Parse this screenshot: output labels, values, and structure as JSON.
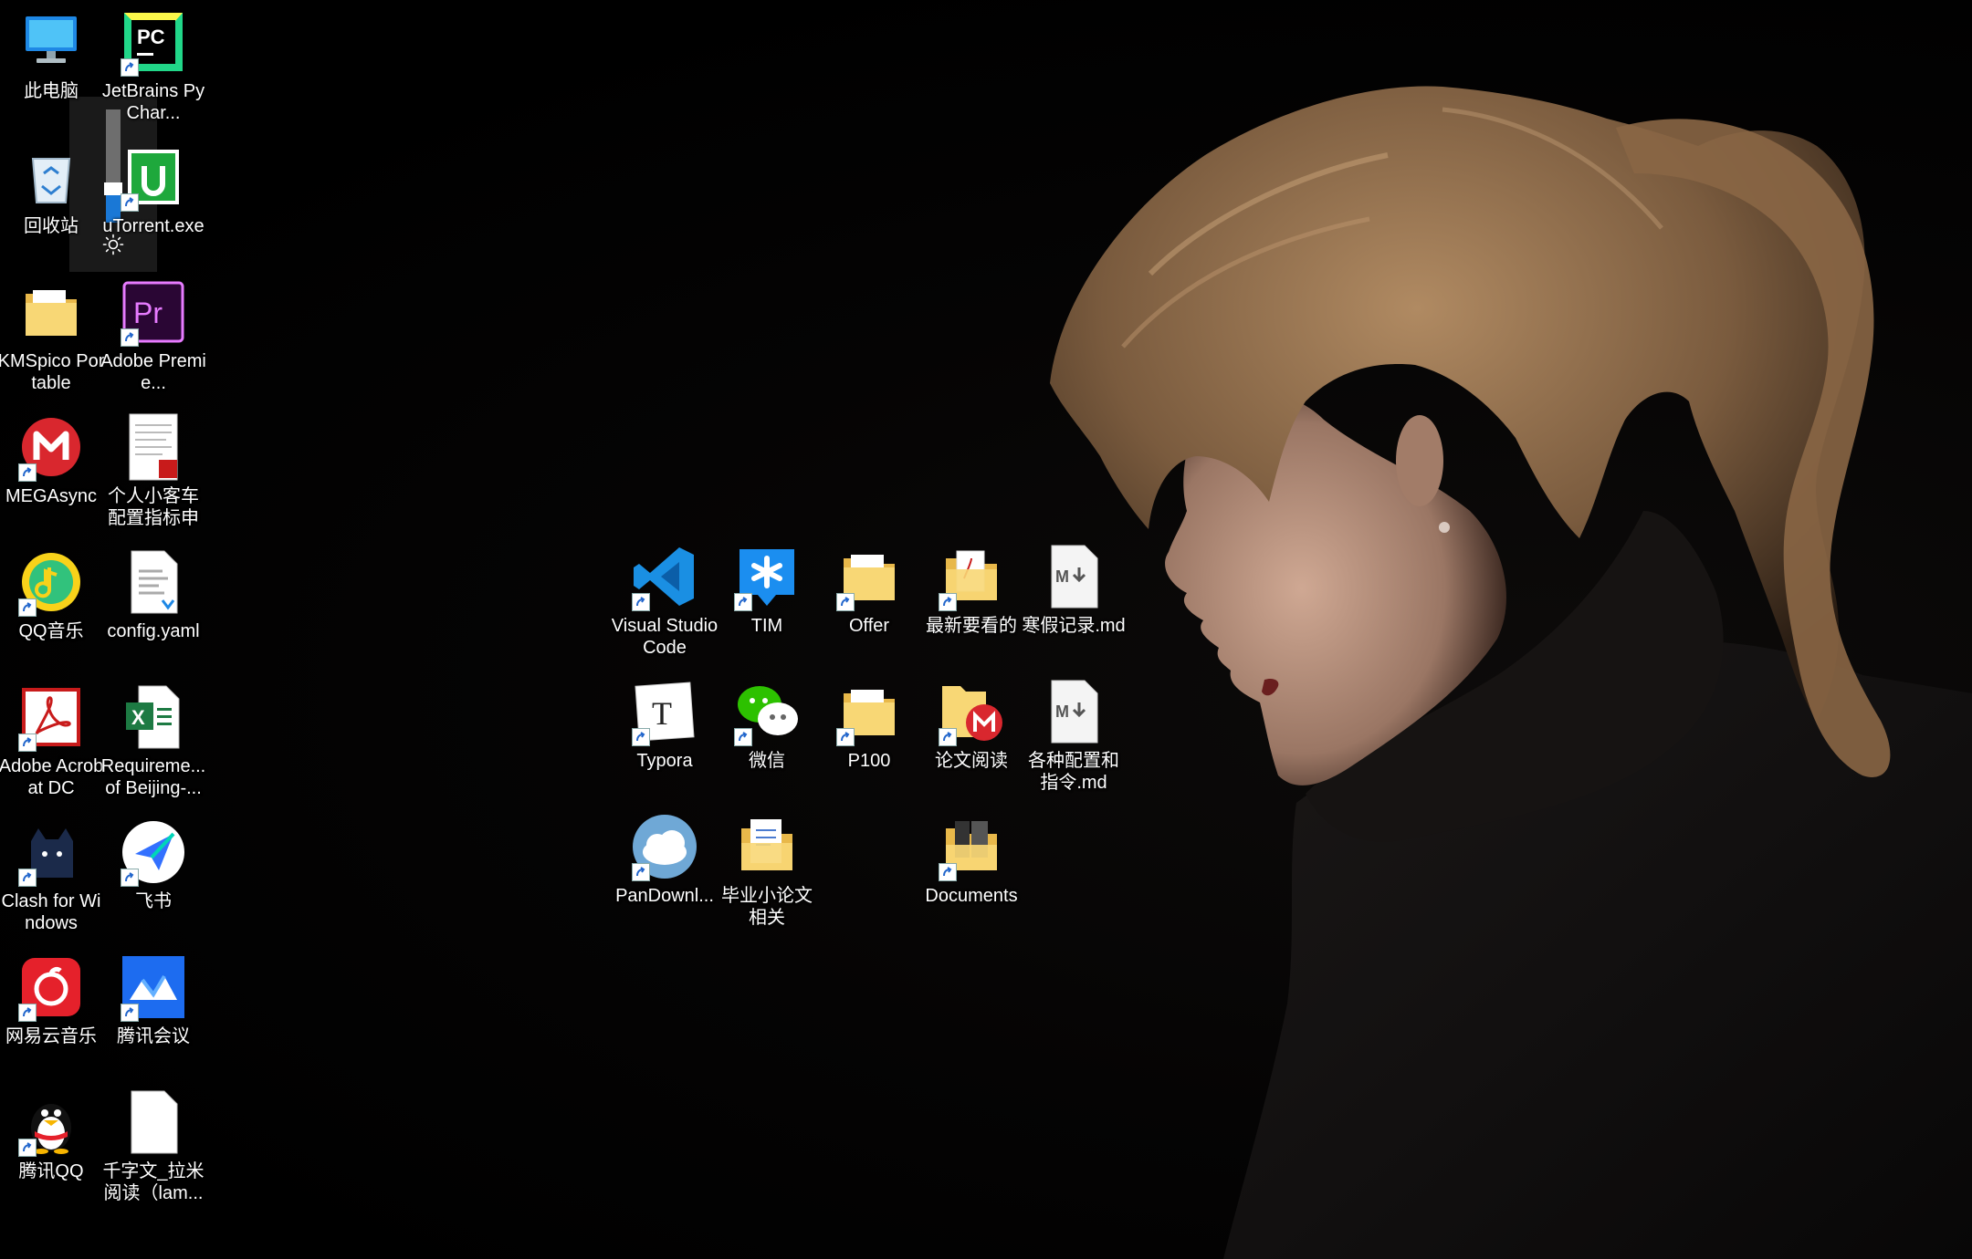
{
  "desktop": {
    "brightness_level": 0.3,
    "left_column_a": [
      {
        "key": "this-pc",
        "label": "此电脑",
        "icon": "this-pc-icon",
        "shortcut": false
      },
      {
        "key": "recycle-bin",
        "label": "回收站",
        "icon": "recycle-bin-icon",
        "shortcut": false
      },
      {
        "key": "kmspico",
        "label": "KMSpico Portable",
        "icon": "folder-icon",
        "shortcut": false
      },
      {
        "key": "megasync",
        "label": "MEGAsync",
        "icon": "mega-icon",
        "shortcut": true
      },
      {
        "key": "qqmusic",
        "label": "QQ音乐",
        "icon": "qq-music-icon",
        "shortcut": true
      },
      {
        "key": "acrobat",
        "label": "Adobe Acrobat DC",
        "icon": "acrobat-icon",
        "shortcut": true
      },
      {
        "key": "clash",
        "label": "Clash for Windows",
        "icon": "clash-cat-icon",
        "shortcut": true
      },
      {
        "key": "netease",
        "label": "网易云音乐",
        "icon": "netease-music-icon",
        "shortcut": true
      },
      {
        "key": "tencent-qq",
        "label": "腾讯QQ",
        "icon": "qq-penguin-icon",
        "shortcut": true
      }
    ],
    "left_column_b": [
      {
        "key": "pycharm",
        "label": "JetBrains PyChar...",
        "icon": "pycharm-icon",
        "shortcut": true
      },
      {
        "key": "utorrent",
        "label": "uTorrent.exe",
        "icon": "utorrent-icon",
        "shortcut": true
      },
      {
        "key": "premiere",
        "label": "Adobe Premie...",
        "icon": "premiere-icon",
        "shortcut": true
      },
      {
        "key": "pdf-doc",
        "label": "个人小客车配置指标申请...",
        "icon": "pdf-document-icon",
        "shortcut": false
      },
      {
        "key": "config-yaml",
        "label": "config.yaml",
        "icon": "yaml-file-icon",
        "shortcut": false
      },
      {
        "key": "requirements",
        "label": "Requireme... of Beijing-...",
        "icon": "excel-file-icon",
        "shortcut": false
      },
      {
        "key": "feishu",
        "label": "飞书",
        "icon": "feishu-icon",
        "shortcut": true
      },
      {
        "key": "tencent-meeting",
        "label": "腾讯会议",
        "icon": "tencent-meeting-icon",
        "shortcut": true
      },
      {
        "key": "text-file",
        "label": "千字文_拉米阅读（lam...",
        "icon": "text-file-icon",
        "shortcut": false
      }
    ],
    "center_grid": [
      {
        "key": "vscode",
        "label": "Visual Studio Code",
        "icon": "vscode-icon",
        "shortcut": true,
        "col": 0,
        "row": 0
      },
      {
        "key": "tim",
        "label": "TIM",
        "icon": "tim-icon",
        "shortcut": true,
        "col": 1,
        "row": 0
      },
      {
        "key": "offer",
        "label": "Offer",
        "icon": "folder-icon",
        "shortcut": true,
        "col": 2,
        "row": 0
      },
      {
        "key": "latest",
        "label": "最新要看的",
        "icon": "pdf-folder-icon",
        "shortcut": true,
        "col": 3,
        "row": 0
      },
      {
        "key": "winter-md",
        "label": "寒假记录.md",
        "icon": "markdown-file-icon",
        "shortcut": false,
        "col": 4,
        "row": 0
      },
      {
        "key": "typora",
        "label": "Typora",
        "icon": "typora-icon",
        "shortcut": true,
        "col": 0,
        "row": 1
      },
      {
        "key": "wechat",
        "label": "微信",
        "icon": "wechat-icon",
        "shortcut": true,
        "col": 1,
        "row": 1
      },
      {
        "key": "p100",
        "label": "P100",
        "icon": "folder-icon",
        "shortcut": true,
        "col": 2,
        "row": 1
      },
      {
        "key": "paper-reading",
        "label": "论文阅读",
        "icon": "mega-folder-icon",
        "shortcut": true,
        "col": 3,
        "row": 1
      },
      {
        "key": "config-md",
        "label": "各种配置和指令.md",
        "icon": "markdown-file-icon",
        "shortcut": false,
        "col": 4,
        "row": 1
      },
      {
        "key": "pandownload",
        "label": "PanDownl...",
        "icon": "pandownload-cloud-icon",
        "shortcut": true,
        "col": 0,
        "row": 2
      },
      {
        "key": "thesis",
        "label": "毕业小论文相关",
        "icon": "document-folder-icon",
        "shortcut": false,
        "col": 1,
        "row": 2
      },
      {
        "key": "documents",
        "label": "Documents",
        "icon": "documents-folder-icon",
        "shortcut": true,
        "col": 3,
        "row": 2
      }
    ]
  }
}
